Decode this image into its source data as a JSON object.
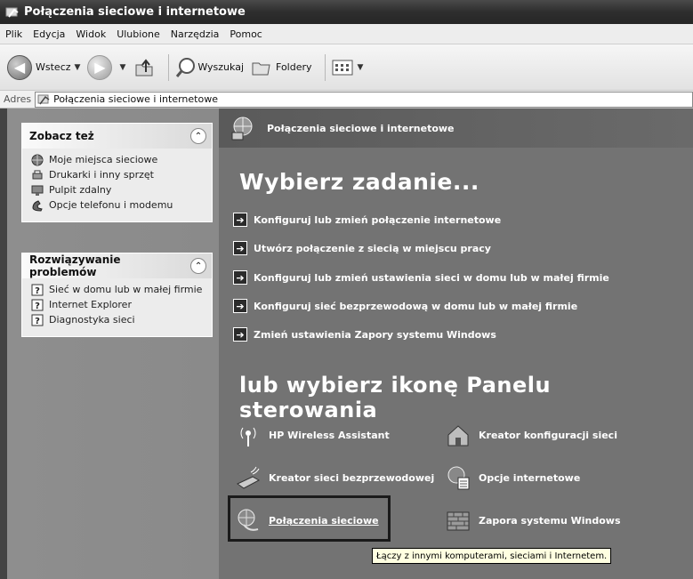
{
  "window": {
    "title": "Połączenia sieciowe i internetowe"
  },
  "menu": [
    "Plik",
    "Edycja",
    "Widok",
    "Ulubione",
    "Narzędzia",
    "Pomoc"
  ],
  "toolbar": {
    "back_label": "Wstecz",
    "search_label": "Wyszukaj",
    "folders_label": "Foldery"
  },
  "address": {
    "label": "Adres",
    "value": "Połączenia sieciowe i internetowe"
  },
  "see_also": {
    "title": "Zobacz też",
    "items": [
      "Moje miejsca sieciowe",
      "Drukarki i inny sprzęt",
      "Pulpit zdalny",
      "Opcje telefonu i modemu"
    ]
  },
  "troubleshoot": {
    "title": "Rozwiązywanie problemów",
    "items": [
      "Sieć w domu lub w małej firmie",
      "Internet Explorer",
      "Diagnostyka sieci"
    ]
  },
  "main": {
    "header": "Połączenia sieciowe i internetowe",
    "task_title": "Wybierz zadanie...",
    "tasks": [
      "Konfiguruj lub zmień połączenie internetowe",
      "Utwórz połączenie z siecią w miejscu pracy",
      "Konfiguruj lub zmień ustawienia sieci w domu lub w małej firmie",
      "Konfiguruj sieć bezprzewodową w domu lub w małej firmie",
      "Zmień ustawienia Zapory systemu Windows"
    ],
    "icons_title": "lub wybierz ikonę Panelu sterowania",
    "icons": [
      "HP Wireless Assistant",
      "Kreator konfiguracji sieci",
      "Kreator sieci bezprzewodowej",
      "Opcje internetowe",
      "Połączenia sieciowe",
      "Zapora systemu Windows"
    ]
  },
  "tooltip": "Łączy z innymi komputerami, sieciami i Internetem."
}
